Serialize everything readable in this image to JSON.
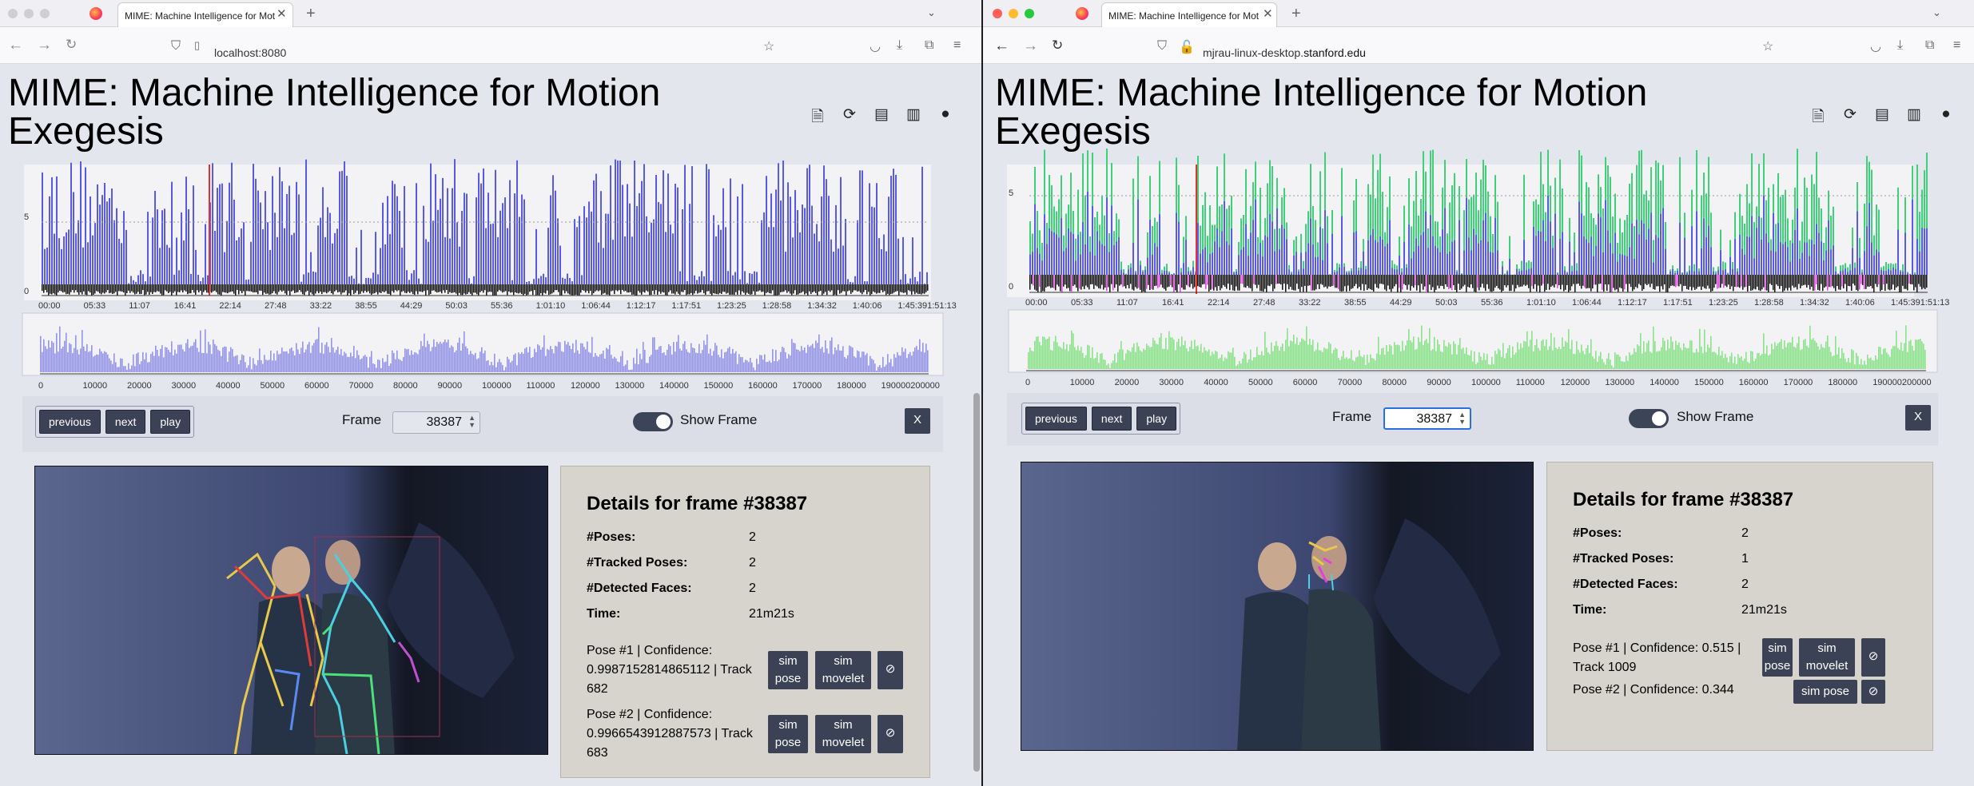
{
  "left": {
    "tab_title": "MIME: Machine Intelligence for Motion Exegesis",
    "url_host": "localhost:8080",
    "url_domain": "",
    "page_title": "MIME: Machine Intelligence for Motion Exegesis",
    "y_ticks": [
      "5",
      "0"
    ],
    "time_ticks": [
      "00:00",
      "05:33",
      "11:07",
      "16:41",
      "22:14",
      "27:48",
      "33:22",
      "38:55",
      "44:29",
      "50:03",
      "55:36",
      "1:01:10",
      "1:06:44",
      "1:12:17",
      "1:17:51",
      "1:23:25",
      "1:28:58",
      "1:34:32",
      "1:40:06",
      "1:45:391:51:13"
    ],
    "frame_ticks": [
      "0",
      "10000",
      "20000",
      "30000",
      "40000",
      "50000",
      "60000",
      "70000",
      "80000",
      "90000",
      "100000",
      "110000",
      "120000",
      "130000",
      "140000",
      "150000",
      "160000",
      "170000",
      "180000",
      "190000200000"
    ],
    "buttons": {
      "previous": "previous",
      "next": "next",
      "play": "play"
    },
    "frame_label": "Frame",
    "frame_value": "38387",
    "show_frame_label": "Show Frame",
    "close_label": "X",
    "details": {
      "title": "Details for frame #38387",
      "rows": [
        {
          "label": "#Poses:",
          "value": "2"
        },
        {
          "label": "#Tracked Poses:",
          "value": "2"
        },
        {
          "label": "#Detected Faces:",
          "value": "2"
        },
        {
          "label": "Time:",
          "value": "21m21s"
        }
      ],
      "poses": [
        {
          "line1": "Pose #1 | Confidence:",
          "line2": "0.9987152814865112 | Track",
          "line3": "682",
          "sim_pose": "sim pose",
          "sim_movelet": "sim movelet"
        },
        {
          "line1": "Pose #2 | Confidence:",
          "line2": "0.9966543912887573 | Track",
          "line3": "683",
          "sim_pose": "sim pose",
          "sim_movelet": "sim movelet"
        }
      ]
    }
  },
  "right": {
    "tab_title": "MIME: Machine Intelligence for Motion Exegesis",
    "url_host": "mjrau-linux-desktop.",
    "url_domain": "stanford.edu",
    "page_title": "MIME: Machine Intelligence for Motion Exegesis",
    "y_ticks": [
      "5",
      "0"
    ],
    "time_ticks": [
      "00:00",
      "05:33",
      "11:07",
      "16:41",
      "22:14",
      "27:48",
      "33:22",
      "38:55",
      "44:29",
      "50:03",
      "55:36",
      "1:01:10",
      "1:06:44",
      "1:12:17",
      "1:17:51",
      "1:23:25",
      "1:28:58",
      "1:34:32",
      "1:40:06",
      "1:45:391:51:13"
    ],
    "frame_ticks": [
      "0",
      "10000",
      "20000",
      "30000",
      "40000",
      "50000",
      "60000",
      "70000",
      "80000",
      "90000",
      "100000",
      "110000",
      "120000",
      "130000",
      "140000",
      "150000",
      "160000",
      "170000",
      "180000",
      "190000200000"
    ],
    "buttons": {
      "previous": "previous",
      "next": "next",
      "play": "play"
    },
    "frame_label": "Frame",
    "frame_value": "38387",
    "show_frame_label": "Show Frame",
    "close_label": "X",
    "details": {
      "title": "Details for frame #38387",
      "rows": [
        {
          "label": "#Poses:",
          "value": "2"
        },
        {
          "label": "#Tracked Poses:",
          "value": "1"
        },
        {
          "label": "#Detected Faces:",
          "value": "2"
        },
        {
          "label": "Time:",
          "value": "21m21s"
        }
      ],
      "poses": [
        {
          "line1": "Pose #1 | Confidence: 0.515 |",
          "line2": "Track 1009",
          "sim_pose": "sim pose",
          "sim_movelet": "sim movelet"
        },
        {
          "line1": "Pose #2 | Confidence: 0.344",
          "sim_pose": "sim pose"
        }
      ]
    }
  },
  "colors": {
    "bars": "#5a5ae8",
    "bars_green": "#3fd07a",
    "marker": "#e63030",
    "tracks": "#111111",
    "tracks_magenta": "#e040e0",
    "hist": "#8a8ae6",
    "hist_green": "#7fe07f",
    "button": "#3b4256"
  },
  "icons": [
    "back-icon",
    "forward-icon",
    "reload-icon",
    "shield-icon",
    "lock-icon",
    "bookmark-star-icon",
    "pocket-icon",
    "download-icon",
    "extensions-icon",
    "menu-icon",
    "document-icon",
    "refresh-circle-icon",
    "notebook-icon",
    "book-icon",
    "github-icon",
    "eye-slash-icon"
  ]
}
